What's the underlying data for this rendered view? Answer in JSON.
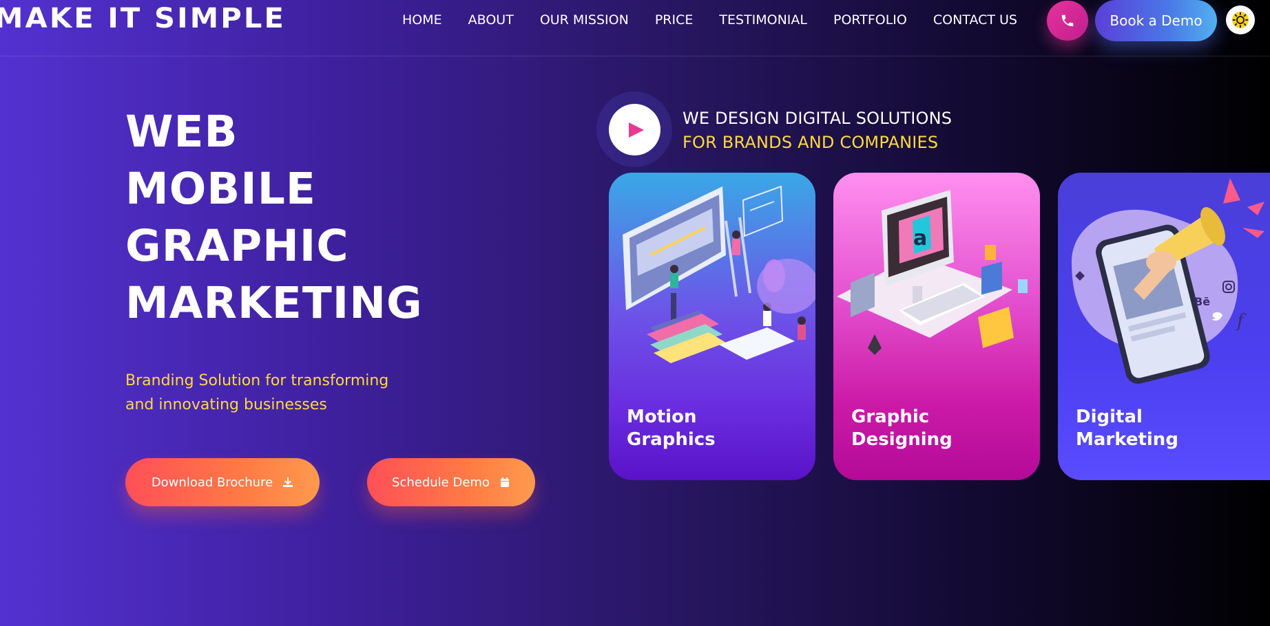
{
  "header": {
    "logo": "MAKE IT SIMPLE",
    "nav": [
      {
        "label": "HOME"
      },
      {
        "label": "ABOUT"
      },
      {
        "label": "OUR MISSION"
      },
      {
        "label": "PRICE"
      },
      {
        "label": "TESTIMONIAL"
      },
      {
        "label": "PORTFOLIO"
      },
      {
        "label": "CONTACT US"
      }
    ],
    "phone_icon": "phone-icon",
    "book_demo_label": "Book a Demo",
    "theme_icon": "sun-icon"
  },
  "hero": {
    "title_lines": [
      "WEB",
      "MOBILE",
      "GRAPHIC",
      "MARKETING"
    ],
    "subtitle": "Branding Solution for transforming and innovating businesses",
    "download_label": "Download Brochure",
    "download_icon": "download-icon",
    "schedule_label": "Schedule Demo",
    "schedule_icon": "calendar-icon"
  },
  "showcase": {
    "tagline_line1": "WE DESIGN DIGITAL SOLUTIONS",
    "tagline_line2": "FOR BRANDS AND COMPANIES",
    "play_icon": "play-icon",
    "cards": [
      {
        "title_line1": "Motion",
        "title_line2": "Graphics",
        "illustration": "motion-graphics-illustration"
      },
      {
        "title_line1": "Graphic",
        "title_line2": "Designing",
        "illustration": "graphic-design-illustration"
      },
      {
        "title_line1": "Digital",
        "title_line2": "Marketing",
        "illustration": "digital-marketing-illustration"
      }
    ]
  },
  "colors": {
    "accent_yellow": "#ffd93d",
    "cta_gradient_start": "#ff4f58",
    "cta_gradient_end": "#ff9a4d",
    "phone_pink": "#e6329c",
    "play_pink": "#e83a8f"
  }
}
